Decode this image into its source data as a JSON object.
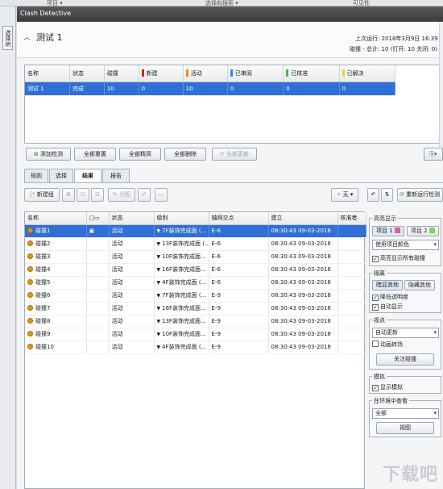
{
  "topbar": {
    "left": "项目 ▾",
    "mid": "选择和搜索 ▾",
    "right": "可见性"
  },
  "side_tab": "选择树",
  "window_title": "Clash Detective",
  "test": {
    "name": "测试 1",
    "last_run": "上次运行: 2018年3月9日 16:39",
    "summary": "碰撞 - 总计: 10 (打开: 10  关闭: 0)"
  },
  "tests_table": {
    "headers": [
      "名称",
      "状态",
      "碰撞",
      "新建",
      "活动",
      "已审阅",
      "已核准",
      "已解决"
    ],
    "header_colors": [
      "",
      "",
      "",
      "#d81e1e",
      "#f08c12",
      "#2a8ee8",
      "#3cc03c",
      "#e8d430"
    ],
    "rows": [
      [
        "测试 1",
        "完成",
        "10",
        "0",
        "10",
        "0",
        "0",
        "0"
      ]
    ]
  },
  "test_buttons": {
    "add": "添加检测",
    "reset_all": "全部重置",
    "compact_all": "全部精简",
    "delete_all": "全部删除",
    "update_all": "全部更新"
  },
  "tabs": [
    "规则",
    "选择",
    "结果",
    "报告"
  ],
  "active_tab": "结果",
  "result_toolbar": {
    "new_group": "新建组",
    "assign": "分配",
    "filter": "无",
    "rerun": "重新运行检测"
  },
  "results_table": {
    "headers": [
      "名称",
      "",
      "状态",
      "级别",
      "轴网交点",
      "建立",
      "核准者"
    ],
    "rows": [
      {
        "name": "碰撞1",
        "status": "活动",
        "level": "7F装饰完成面 (...",
        "grid": "E-6",
        "created": "08:30:43 09-03-2018",
        "selected": true
      },
      {
        "name": "碰撞2",
        "status": "活动",
        "level": "13F装饰完成面 (...",
        "grid": "E-6",
        "created": "08:30:43 09-03-2018",
        "selected": false
      },
      {
        "name": "碰撞3",
        "status": "活动",
        "level": "10F装饰完成面...",
        "grid": "E-6",
        "created": "08:30:43 09-03-2018",
        "selected": false
      },
      {
        "name": "碰撞4",
        "status": "活动",
        "level": "16F装饰完成面...",
        "grid": "E-6",
        "created": "08:30:43 09-03-2018",
        "selected": false
      },
      {
        "name": "碰撞5",
        "status": "活动",
        "level": "4F装饰完成面 (...",
        "grid": "E-6",
        "created": "08:30:43 09-03-2018",
        "selected": false
      },
      {
        "name": "碰撞6",
        "status": "活动",
        "level": "7F装饰完成面 (...",
        "grid": "E-9",
        "created": "08:30:43 09-03-2018",
        "selected": false
      },
      {
        "name": "碰撞7",
        "status": "活动",
        "level": "16F装饰完成面...",
        "grid": "E-9",
        "created": "08:30:43 09-03-2018",
        "selected": false
      },
      {
        "name": "碰撞8",
        "status": "活动",
        "level": "13F装饰完成面...",
        "grid": "E-9",
        "created": "08:30:43 09-03-2018",
        "selected": false
      },
      {
        "name": "碰撞9",
        "status": "活动",
        "level": "10F装饰完成面...",
        "grid": "E-9",
        "created": "08:30:43 09-03-2018",
        "selected": false
      },
      {
        "name": "碰撞10",
        "status": "活动",
        "level": "4F装饰完成面 (...",
        "grid": "E-9",
        "created": "08:30:43 09-03-2018",
        "selected": false
      }
    ]
  },
  "highlight": {
    "title": "高亮显示",
    "item1": "项目 1",
    "item2": "项目 2",
    "item1_color": "#e25b9d",
    "item2_color": "#7bd36a",
    "color_mode": "使用项目颜色",
    "show_all": "高亮显示所有碰撞"
  },
  "isolate": {
    "title": "隔离",
    "dim_others": "暗显其他",
    "hide_others": "隐藏其他",
    "lower_transparency": "降低透明度",
    "auto_show": "自动显示"
  },
  "viewpoint": {
    "title": "视点",
    "mode": "自动更新",
    "animate": "动画转场",
    "focus": "关注碰撞"
  },
  "simulation": {
    "title": "模拟",
    "show": "显示模拟"
  },
  "env": {
    "title": "在环境中查看",
    "mode": "全部",
    "view": "视图"
  },
  "watermark": "下载吧"
}
